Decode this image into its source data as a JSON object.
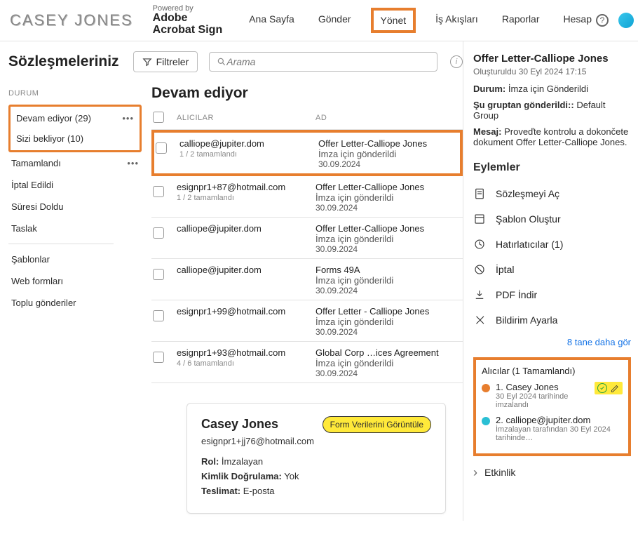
{
  "header": {
    "logo": "CASEY JONES",
    "powered_by": "Powered by",
    "brand_line1": "Adobe",
    "brand_line2": "Acrobat Sign",
    "nav": {
      "home": "Ana Sayfa",
      "send": "Gönder",
      "manage": "Yönet",
      "workflows": "İş Akışları",
      "reports": "Raporlar",
      "account": "Hesap"
    }
  },
  "page": {
    "title": "Sözleşmeleriniz",
    "filter_label": "Filtreler",
    "search_placeholder": "Arama"
  },
  "sidebar": {
    "durum_label": "DURUM",
    "devam": "Devam ediyor (29)",
    "bekliyor": "Sizi bekliyor  (10)",
    "tamamlandi": "Tamamlandı",
    "iptal": "İptal Edildi",
    "suresi": "Süresi Doldu",
    "taslak": "Taslak",
    "sablonlar": "Şablonlar",
    "web": "Web formları",
    "toplu": "Toplu gönderiler"
  },
  "content": {
    "title": "Devam ediyor",
    "col_recip": "ALICILAR",
    "col_name": "AD"
  },
  "rows": [
    {
      "recip": "calliope@jupiter.dom",
      "sub": "1 / 2 tamamlandı",
      "title": "Offer Letter-Calliope Jones",
      "status": "İmza için gönderildi",
      "date": "30.09.2024"
    },
    {
      "recip": "esignpr1+87@hotmail.com",
      "sub": "1 / 2 tamamlandı",
      "title": "Offer Letter-Calliope Jones",
      "status": "İmza için gönderildi",
      "date": "30.09.2024"
    },
    {
      "recip": "calliope@jupiter.dom",
      "sub": "",
      "title": "Offer Letter-Calliope Jones",
      "status": "İmza için gönderildi",
      "date": "30.09.2024"
    },
    {
      "recip": "calliope@jupiter.dom",
      "sub": "",
      "title": "Forms 49A",
      "status": "İmza için gönderildi",
      "date": "30.09.2024"
    },
    {
      "recip": "esignpr1+99@hotmail.com",
      "sub": "",
      "title": "Offer Letter - Calliope Jones",
      "status": "İmza için gönderildi",
      "date": "30.09.2024"
    },
    {
      "recip": "esignpr1+93@hotmail.com",
      "sub": "4 / 6 tamamlandı",
      "title": "Global Corp …ices Agreement",
      "status": "İmza için gönderildi",
      "date": "30.09.2024"
    }
  ],
  "card": {
    "name": "Casey Jones",
    "form_btn": "Form Verilerini Görüntüle",
    "email": "esignpr1+jj76@hotmail.com",
    "rol_label": "Rol:",
    "rol_value": "İmzalayan",
    "kimlik_label": "Kimlik Doğrulama:",
    "kimlik_value": "Yok",
    "teslimat_label": "Teslimat:",
    "teslimat_value": "E-posta"
  },
  "right": {
    "title": "Offer Letter-Calliope Jones",
    "created": "Oluşturuldu 30 Eyl 2024 17:15",
    "durum_label": "Durum:",
    "durum_value": "İmza için Gönderildi",
    "grup_label": "Şu gruptan gönderildi::",
    "grup_value": "Default Group",
    "mesaj_label": "Mesaj:",
    "mesaj_value": "Proveďte kontrolu a dokončete dokument Offer Letter-Calliope Jones.",
    "actions_head": "Eylemler",
    "actions": {
      "open": "Sözleşmeyi Aç",
      "template": "Şablon Oluştur",
      "reminders": "Hatırlatıcılar (1)",
      "cancel": "İptal",
      "pdf": "PDF İndir",
      "notify": "Bildirim Ayarla"
    },
    "more_link": "8 tane daha gör",
    "recip_head": "Alıcılar (1 Tamamlandı)",
    "recip1_name": "1. Casey Jones",
    "recip1_sub": "30 Eyl 2024 tarihinde imzalandı",
    "recip2_name": "2. calliope@jupiter.dom",
    "recip2_sub": "İmzalayan tarafından 30 Eyl 2024 tarihinde…",
    "activity": "Etkinlik"
  }
}
